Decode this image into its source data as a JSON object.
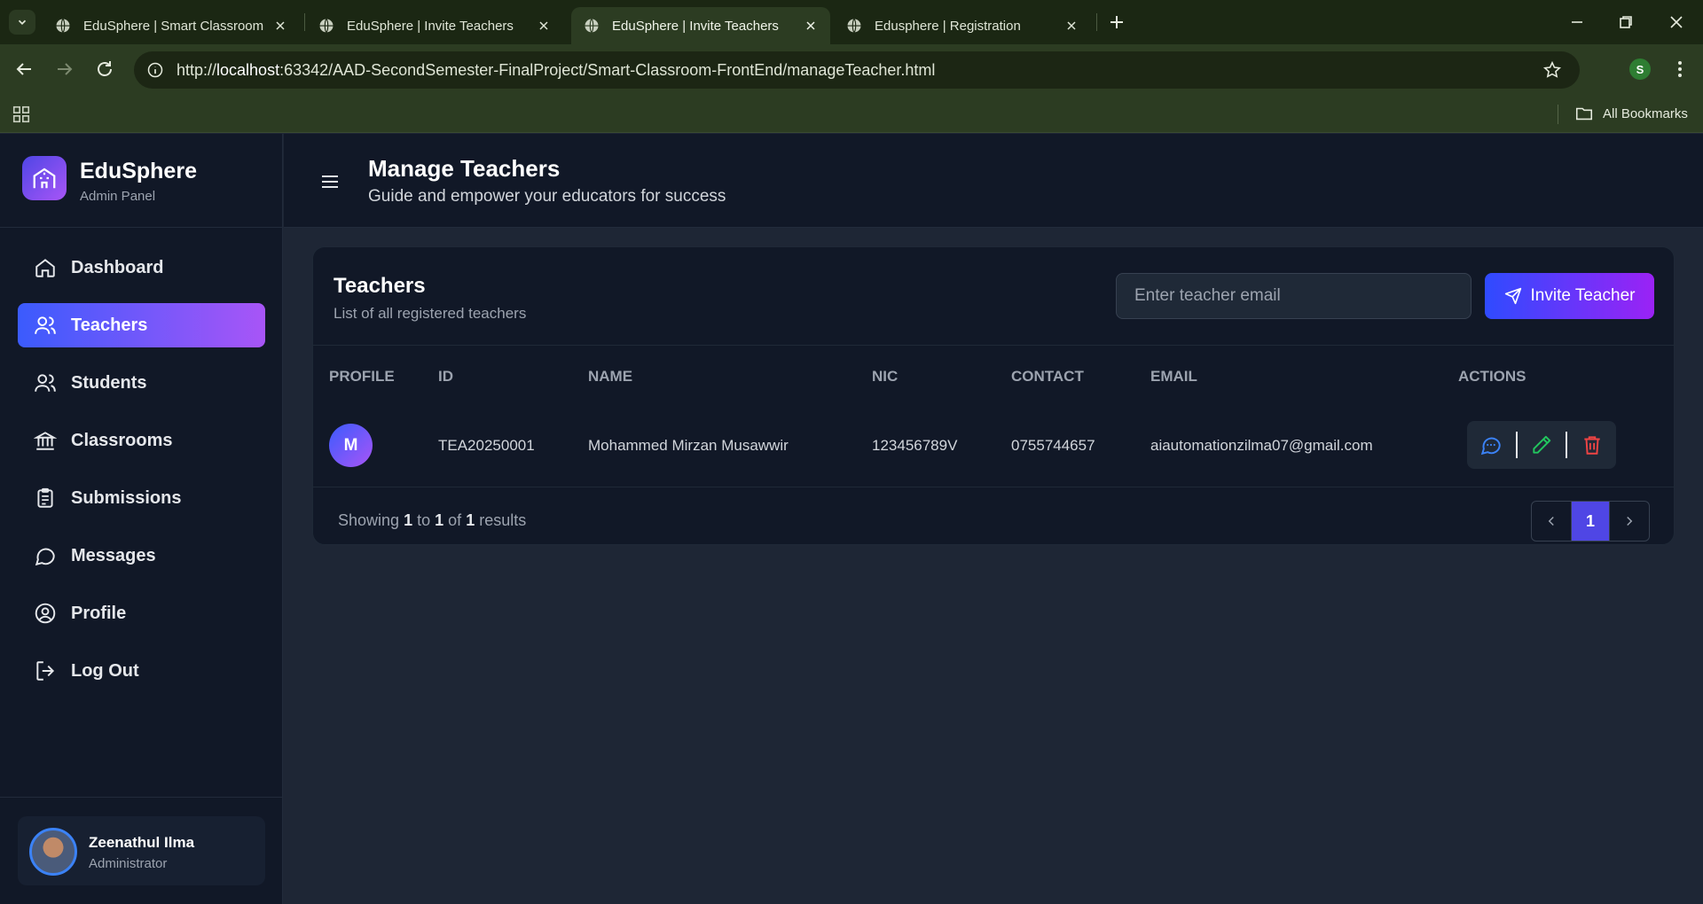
{
  "browser": {
    "tabs": [
      {
        "title": "EduSphere | Smart Classroom"
      },
      {
        "title": "EduSphere | Invite Teachers"
      },
      {
        "title": "EduSphere | Invite Teachers"
      },
      {
        "title": "Edusphere | Registration"
      }
    ],
    "url_prefix": "http://",
    "url_host": "localhost",
    "url_rest": ":63342/AAD-SecondSemester-FinalProject/Smart-Classroom-FrontEnd/manageTeacher.html",
    "profile_initial": "S",
    "all_bookmarks": "All Bookmarks"
  },
  "brand": {
    "name": "EduSphere",
    "subtitle": "Admin Panel"
  },
  "sidebar": {
    "items": [
      {
        "label": "Dashboard",
        "icon": "home-icon"
      },
      {
        "label": "Teachers",
        "icon": "users-icon",
        "active": true
      },
      {
        "label": "Students",
        "icon": "users-icon"
      },
      {
        "label": "Classrooms",
        "icon": "bank-icon"
      },
      {
        "label": "Submissions",
        "icon": "clipboard-icon"
      },
      {
        "label": "Messages",
        "icon": "message-circle-icon"
      },
      {
        "label": "Profile",
        "icon": "user-circle-icon"
      },
      {
        "label": "Log Out",
        "icon": "logout-icon"
      }
    ]
  },
  "user": {
    "name": "Zeenathul Ilma",
    "role": "Administrator"
  },
  "header": {
    "title": "Manage Teachers",
    "subtitle": "Guide and empower your educators for success"
  },
  "teachers_card": {
    "title": "Teachers",
    "subtitle": "List of all registered teachers",
    "email_placeholder": "Enter teacher email",
    "invite_label": "Invite Teacher",
    "columns": [
      "PROFILE",
      "ID",
      "NAME",
      "NIC",
      "CONTACT",
      "EMAIL",
      "ACTIONS"
    ],
    "rows": [
      {
        "initial": "M",
        "id": "TEA20250001",
        "name": "Mohammed Mirzan Musawwir",
        "nic": "123456789V",
        "contact": "0755744657",
        "email": "aiautomationzilma07@gmail.com"
      }
    ],
    "pagination": {
      "prefix": "Showing",
      "from": "1",
      "to_word": "to",
      "to": "1",
      "of_word": "of",
      "total": "1",
      "suffix": "results",
      "current_page": "1"
    }
  },
  "colors": {
    "accent_start": "#3b5bfd",
    "accent_end": "#a855f7",
    "message_icon": "#3b82f6",
    "edit_icon": "#22c55e",
    "delete_icon": "#ef4444"
  }
}
